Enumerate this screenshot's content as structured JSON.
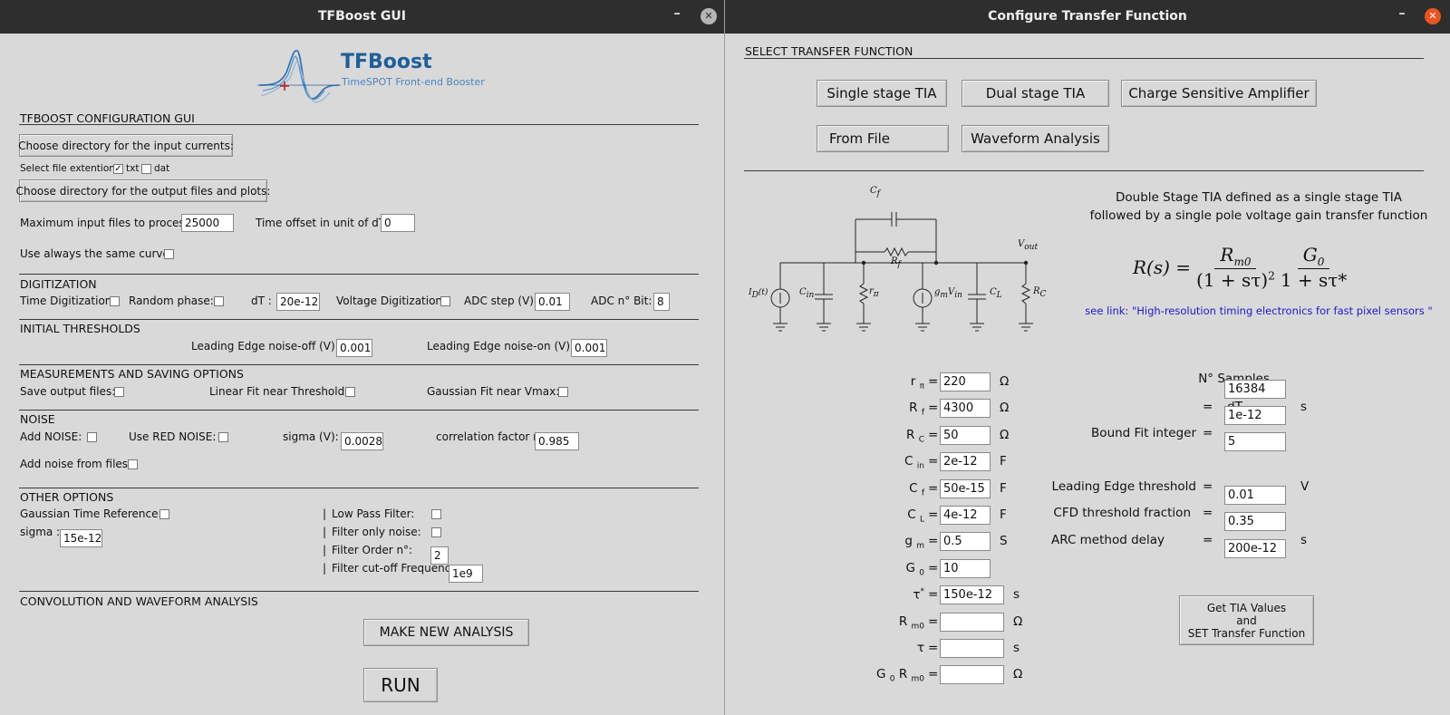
{
  "left_window": {
    "title": "TFBoost GUI",
    "logo": {
      "name": "TFBoost",
      "tagline": "TimeSPOT Front-end Booster"
    },
    "config_header": "TFBOOST CONFIGURATION GUI",
    "choose_input_button": "Choose directory for the input currents:",
    "file_ext_label": "Select file extention:",
    "ext_txt": {
      "label": "txt",
      "checked": true
    },
    "ext_dat": {
      "label": "dat",
      "checked": false
    },
    "choose_output_button": "Choose directory for the output files and plots:",
    "max_files_label": "Maximum input files to process:",
    "max_files_value": "25000",
    "time_offset_label": "Time offset in unit of dT:",
    "time_offset_value": "0",
    "same_curve_label": "Use always the same curve:",
    "digitization": {
      "header": "DIGITIZATION",
      "time_dig_label": "Time Digitization:",
      "random_phase_label": "Random phase:",
      "dt_label": "dT :",
      "dt_value": "20e-12",
      "voltage_dig_label": "Voltage Digitization:",
      "adc_step_label": "ADC step (V):",
      "adc_step_value": "0.01",
      "adc_bits_label": "ADC n° Bit:",
      "adc_bits_value": "8"
    },
    "thresholds": {
      "header": "INITIAL THRESHOLDS",
      "le_off_label": "Leading Edge noise-off (V):",
      "le_off_value": "0.001",
      "le_on_label": "Leading Edge noise-on (V):",
      "le_on_value": "0.001"
    },
    "measurements": {
      "header": "MEASUREMENTS AND SAVING OPTIONS",
      "save_label": "Save output files:",
      "linear_fit_label": "Linear Fit near Threshold:",
      "gauss_fit_label": "Gaussian Fit near Vmax:"
    },
    "noise": {
      "header": "NOISE",
      "add_noise_label": "Add NOISE:",
      "red_noise_label": "Use RED NOISE:",
      "sigma_label": "sigma (V):",
      "sigma_value": "0.0028",
      "corr_label": "correlation factor r :",
      "corr_value": "0.985",
      "noise_files_label": "Add noise from files:"
    },
    "other": {
      "header": "OTHER OPTIONS",
      "gauss_time_ref_label": "Gaussian Time Reference:",
      "sigma_label": "sigma :",
      "sigma_value": "15e-12",
      "low_pass_label": "Low Pass Filter:",
      "filter_noise_label": "Filter only noise:",
      "filter_order_label": "Filter Order n°:",
      "filter_order_value": "2",
      "cutoff_label": "Filter cut-off Frequency:",
      "cutoff_value": "1e9"
    },
    "convolution": {
      "header": "CONVOLUTION AND WAVEFORM ANALYSIS",
      "new_analysis_button": "MAKE NEW ANALYSIS",
      "run_button": "RUN"
    }
  },
  "right_window": {
    "title": "Configure Transfer Function",
    "select_header": "SELECT TRANSFER FUNCTION",
    "tf_buttons": {
      "single": "Single stage TIA",
      "dual": "Dual stage TIA",
      "csa": "Charge Sensitive Amplifier",
      "file": "From File",
      "waveform": "Waveform Analysis"
    },
    "description_line1": "Double Stage TIA defined as a single stage TIA",
    "description_line2": "followed by a single pole voltage gain transfer function",
    "formula": {
      "lhs": "R(s) =",
      "num1": "R",
      "num1_sub": "m0",
      "den1": "(1 + sτ)",
      "den1_sup": "2",
      "num2": "G",
      "num2_sub": "0",
      "den2": "1 + sτ*"
    },
    "link_text": "see link: \"High-resolution timing electronics for fast pixel sensors \"",
    "circuit": {
      "cf": "C",
      "cf_sub": "f",
      "rf": "R",
      "rf_sub": "f",
      "id": "I",
      "id_sub": "D",
      "id_arg": "(t)",
      "cin": "C",
      "cin_sub": "in",
      "rpi": "r",
      "rpi_sub": "π",
      "gm": "g",
      "gm_sub": "m",
      "gm_v": "V",
      "gm_v_sub": "in",
      "cl": "C",
      "cl_sub": "L",
      "rc": "R",
      "rc_sub": "C",
      "vout": "V",
      "vout_sub": "out"
    },
    "params_left": [
      {
        "main": "r",
        "sub": "π",
        "sup": "",
        "eq": "=",
        "value": "220",
        "unit": "Ω"
      },
      {
        "main": "R",
        "sub": "f",
        "sup": "",
        "eq": "=",
        "value": "4300",
        "unit": "Ω"
      },
      {
        "main": "R",
        "sub": "C",
        "sup": "",
        "eq": "=",
        "value": "50",
        "unit": "Ω"
      },
      {
        "main": "C",
        "sub": "in",
        "sup": "",
        "eq": "=",
        "value": "2e-12",
        "unit": "F"
      },
      {
        "main": "C",
        "sub": "f",
        "sup": "",
        "eq": "=",
        "value": "50e-15",
        "unit": "F"
      },
      {
        "main": "C",
        "sub": "L",
        "sup": "",
        "eq": "=",
        "value": "4e-12",
        "unit": "F"
      },
      {
        "main": "g",
        "sub": "m",
        "sup": "",
        "eq": "=",
        "value": "0.5",
        "unit": "S"
      },
      {
        "main": "G",
        "sub": "0",
        "sup": "",
        "eq": "=",
        "value": "10",
        "unit": ""
      },
      {
        "main": "τ",
        "sub": "",
        "sup": "*",
        "eq": "=",
        "value": "150e-12",
        "unit": "s"
      },
      {
        "main": "R",
        "sub": "m0",
        "sup": "",
        "eq": "=",
        "value": "",
        "unit": "Ω"
      },
      {
        "main": "τ",
        "sub": "",
        "sup": "",
        "eq": "=",
        "value": "",
        "unit": "s"
      },
      {
        "main": "G",
        "sub": "0",
        "sup": "",
        "main2": "R",
        "sub2": "m0",
        "eq": "=",
        "value": "",
        "unit": "Ω"
      }
    ],
    "params_right": {
      "samples_label": "N° Samples",
      "samples_value": "16384",
      "dt_label": "dT",
      "dt_eq": "=",
      "dt_value": "1e-12",
      "dt_unit": "s",
      "bound_label": "Bound Fit integer",
      "bound_eq": "=",
      "bound_value": "5",
      "le_label": "Leading Edge threshold",
      "le_eq": "=",
      "le_value": "0.01",
      "le_unit": "V",
      "cfd_label": "CFD threshold fraction",
      "cfd_eq": "=",
      "cfd_value": "0.35",
      "arc_label": "ARC method delay",
      "arc_eq": "=",
      "arc_value": "200e-12",
      "arc_unit": "s"
    },
    "get_tia_button": {
      "line1": "Get TIA Values",
      "line2": "and",
      "line3": "SET Transfer Function"
    }
  },
  "colors": {
    "titlebar": "#2e2e2e",
    "window_bg": "#d9d9d9",
    "close_left": "#b5b5b5",
    "close_right": "#e95420",
    "logo_blue": "#1f5f9a",
    "link_blue": "#1a1acc"
  }
}
